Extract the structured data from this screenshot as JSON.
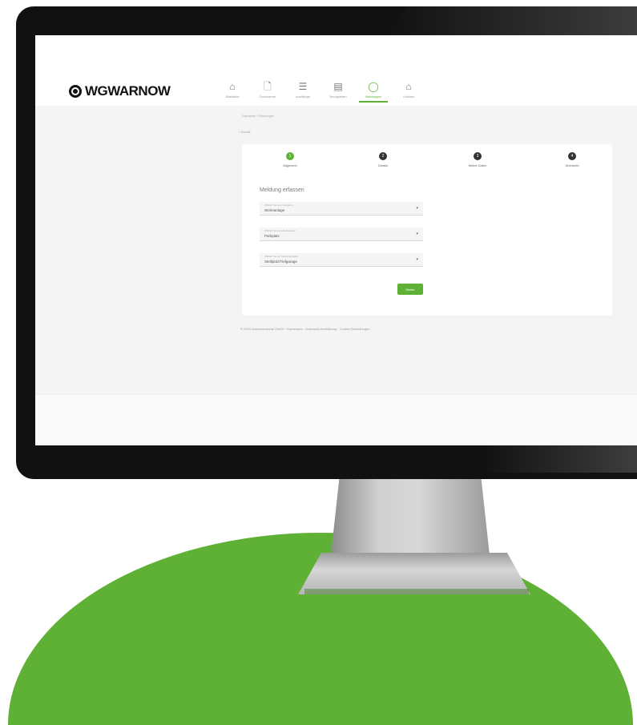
{
  "brand": {
    "logo_text": "WGWARNOW",
    "accent_color": "#5fb135",
    "bezel_color": "#111111"
  },
  "nav": {
    "items": [
      {
        "icon": "home-icon",
        "glyph": "⌂",
        "label": "Startseite"
      },
      {
        "icon": "document-icon",
        "glyph": "🗋",
        "label": "Dokumente"
      },
      {
        "icon": "mailing-icon",
        "glyph": "☰",
        "label": "Aushänge"
      },
      {
        "icon": "newspaper-icon",
        "glyph": "▤",
        "label": "Neuigkeiten"
      },
      {
        "icon": "message-icon",
        "glyph": "◯",
        "label": "Meldungen"
      },
      {
        "icon": "contact-icon",
        "glyph": "⌂",
        "label": "Kontakt"
      }
    ],
    "active_index": 4
  },
  "breadcrumb": "Startseite › Meldungen",
  "back_link": "‹ Zurück",
  "stepper": {
    "steps": [
      {
        "number": "1",
        "label": "Allgemein"
      },
      {
        "number": "2",
        "label": "Details"
      },
      {
        "number": "3",
        "label": "Meine Daten"
      },
      {
        "number": "4",
        "label": "Übersicht"
      }
    ],
    "active_index": 0
  },
  "form": {
    "title": "Meldung erfassen",
    "fields": [
      {
        "label": "Wählen Sie eine Kategorie",
        "value": "Wohnanlage"
      },
      {
        "label": "Wählen Sie eine Meldungsart",
        "value": "Parkplatz"
      },
      {
        "label": "Wählen Sie ein Meldungsobjekt",
        "value": "Stellplatz/Tiefgarage"
      }
    ],
    "next_label": "Weiter"
  },
  "footer": "© 2020 Anwohnerportal GmbH · Impressum · Datenschutzerklärung · Cookie Einstellungen"
}
